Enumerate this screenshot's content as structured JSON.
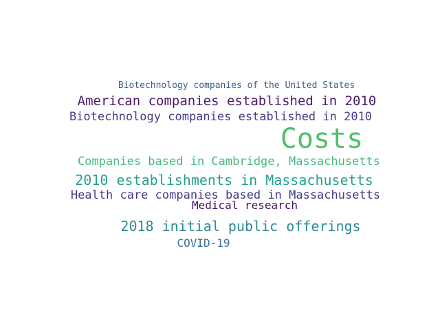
{
  "words": [
    {
      "text": "Biotechnology companies of the United States",
      "color": "#3b5f8a"
    },
    {
      "text": "American companies established in 2010",
      "color": "#4a1a6b"
    },
    {
      "text": "Biotechnology companies established in 2010",
      "color": "#4b3a87"
    },
    {
      "text": "Costs",
      "color": "#4fc06c"
    },
    {
      "text": "Companies based in Cambridge, Massachusetts",
      "color": "#45b880"
    },
    {
      "text": "2010 establishments in Massachusetts",
      "color": "#26a08e"
    },
    {
      "text": "Health care companies based in Massachusetts",
      "color": "#433a86"
    },
    {
      "text": "Medical research",
      "color": "#451062"
    },
    {
      "text": "2018 initial public offerings",
      "color": "#2e8a93"
    },
    {
      "text": "COVID-19",
      "color": "#3b6ea0"
    }
  ]
}
